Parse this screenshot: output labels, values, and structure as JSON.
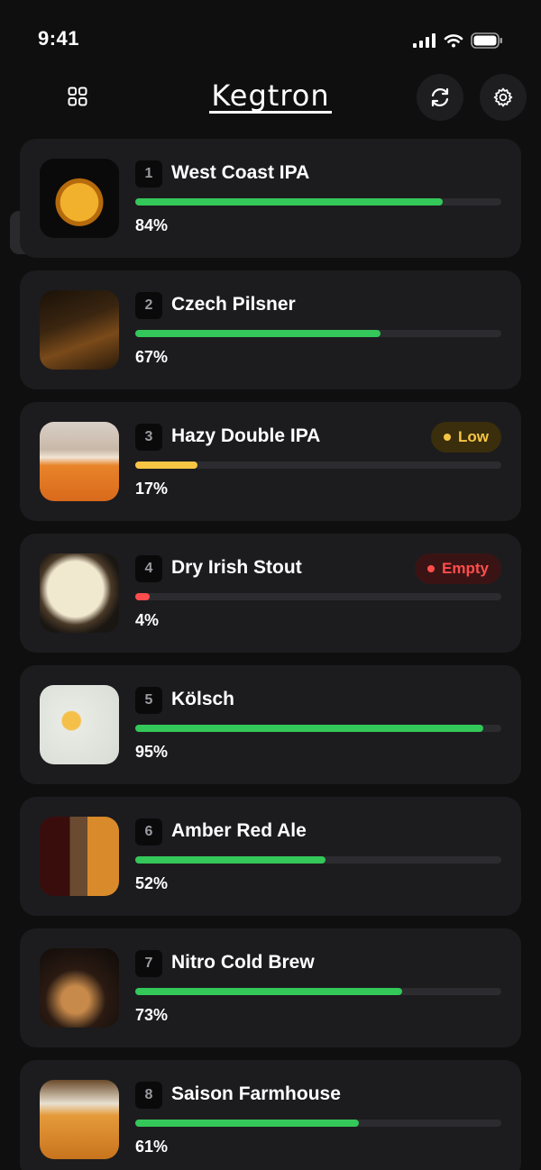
{
  "status_bar": {
    "time": "9:41"
  },
  "app": {
    "title": "Kegtron"
  },
  "colors": {
    "ok": "#34c759",
    "low": "#f7c544",
    "empty": "#ff4d4d"
  },
  "toolbar": {
    "list_icon": "list-icon",
    "grid_icon": "grid-icon",
    "refresh_icon": "refresh-icon",
    "settings_icon": "gear-icon"
  },
  "taps": [
    {
      "number": "1",
      "name": "West Coast IPA",
      "percent_label": "84%",
      "level": 0.84,
      "status": "ok",
      "badge": ""
    },
    {
      "number": "2",
      "name": "Czech Pilsner",
      "percent_label": "67%",
      "level": 0.67,
      "status": "ok",
      "badge": ""
    },
    {
      "number": "3",
      "name": "Hazy Double IPA",
      "percent_label": "17%",
      "level": 0.17,
      "status": "low",
      "badge": "Low"
    },
    {
      "number": "4",
      "name": "Dry Irish Stout",
      "percent_label": "4%",
      "level": 0.04,
      "status": "empty",
      "badge": "Empty"
    },
    {
      "number": "5",
      "name": "Kölsch",
      "percent_label": "95%",
      "level": 0.95,
      "status": "ok",
      "badge": ""
    },
    {
      "number": "6",
      "name": "Amber Red Ale",
      "percent_label": "52%",
      "level": 0.52,
      "status": "ok",
      "badge": ""
    },
    {
      "number": "7",
      "name": "Nitro Cold Brew",
      "percent_label": "73%",
      "level": 0.73,
      "status": "ok",
      "badge": ""
    },
    {
      "number": "8",
      "name": "Saison Farmhouse",
      "percent_label": "61%",
      "level": 0.61,
      "status": "ok",
      "badge": ""
    }
  ]
}
